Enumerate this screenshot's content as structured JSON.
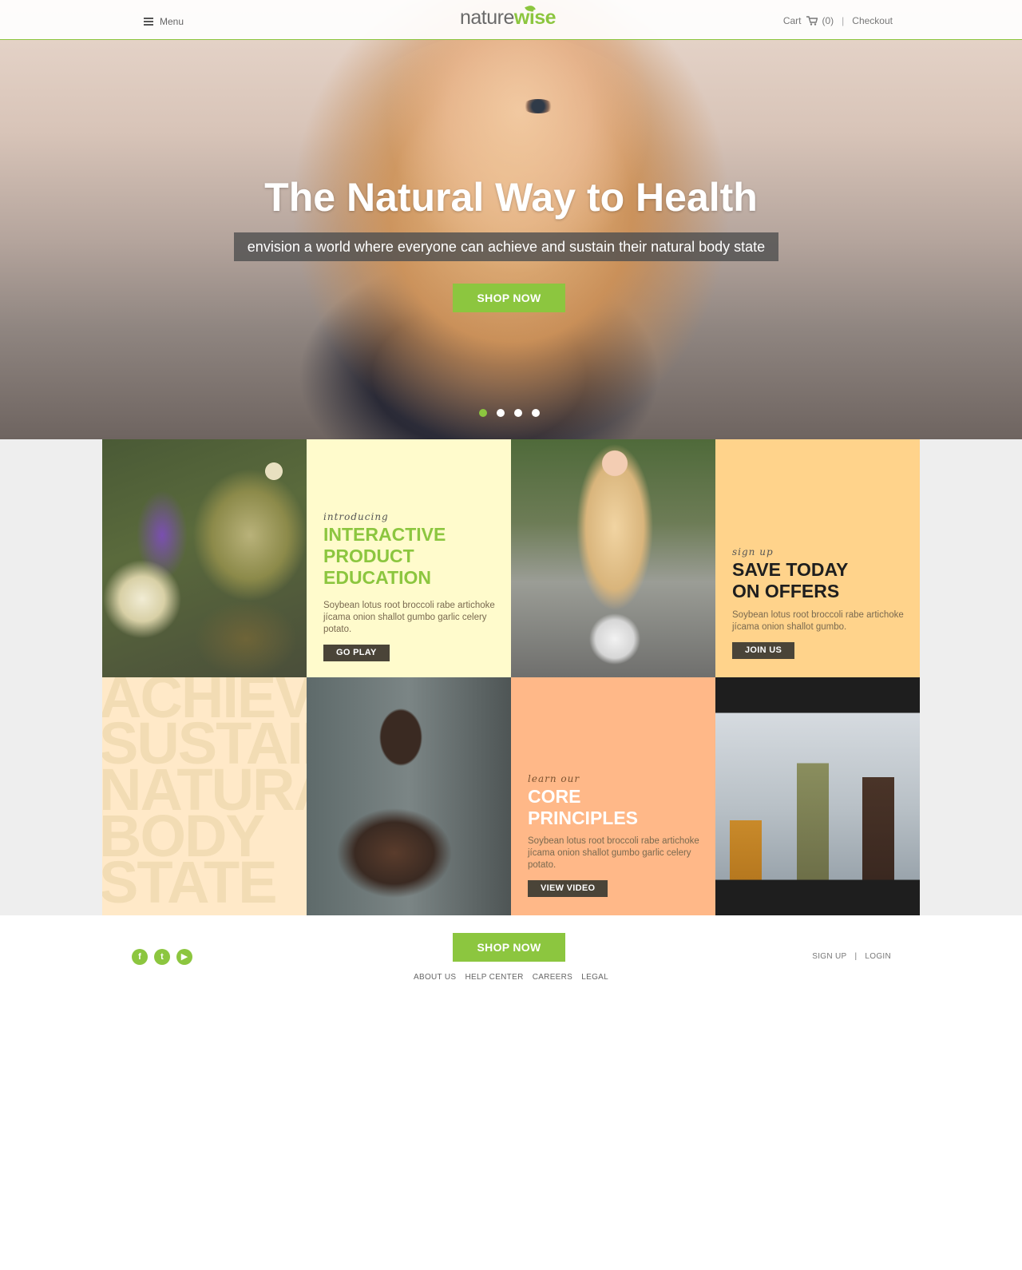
{
  "header": {
    "menu_label": "Menu",
    "logo_part1": "nature",
    "logo_part2": "wise",
    "cart_label": "Cart",
    "cart_count": "(0)",
    "separator": "|",
    "checkout_label": "Checkout"
  },
  "hero": {
    "title": "The Natural Way to Health",
    "subtitle": "envision a world where everyone can achieve and sustain their natural body state",
    "cta_label": "SHOP NOW",
    "slides_total": 4,
    "active_slide": 1
  },
  "tiles": {
    "education": {
      "kicker": "introducing",
      "title_lines": [
        "INTERACTIVE",
        "PRODUCT",
        "EDUCATION"
      ],
      "body": "Soybean lotus root broccoli rabe artichoke jícama onion shallot gumbo garlic celery potato.",
      "button": "GO PLAY"
    },
    "offers": {
      "kicker": "sign up",
      "title_lines": [
        "SAVE TODAY",
        "ON OFFERS"
      ],
      "body": "Soybean lotus root broccoli rabe artichoke jícama onion shallot gumbo.",
      "button": "JOIN US"
    },
    "principles": {
      "kicker": "learn our",
      "title_lines": [
        "CORE",
        "PRINCIPLES"
      ],
      "body": "Soybean lotus root broccoli rabe artichoke jícama onion shallot gumbo garlic celery potato.",
      "button": "VIEW VIDEO"
    },
    "words": [
      "ACHIEVE",
      "SUSTAIN",
      "NATURAL",
      "BODY",
      "STATE"
    ]
  },
  "footer": {
    "social": [
      "f",
      "t",
      "▶"
    ],
    "cta_label": "SHOP NOW",
    "links": [
      "ABOUT US",
      "HELP CENTER",
      "CAREERS",
      "LEGAL"
    ],
    "signup_label": "SIGN UP",
    "separator": "|",
    "login_label": "LOGIN"
  },
  "colors": {
    "accent": "#8cc63f",
    "tile_yellow": "#fffbcc",
    "tile_orange": "#ffd38b",
    "tile_peach": "#ffb888",
    "tile_cream": "#ffe9c8",
    "button_dark": "#4a4438"
  }
}
